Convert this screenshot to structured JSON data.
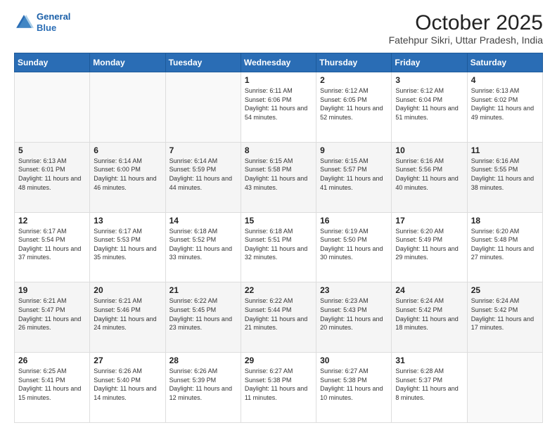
{
  "header": {
    "logo": {
      "line1": "General",
      "line2": "Blue"
    },
    "title": "October 2025",
    "subtitle": "Fatehpur Sikri, Uttar Pradesh, India"
  },
  "weekdays": [
    "Sunday",
    "Monday",
    "Tuesday",
    "Wednesday",
    "Thursday",
    "Friday",
    "Saturday"
  ],
  "weeks": [
    [
      {
        "day": "",
        "sunrise": "",
        "sunset": "",
        "daylight": ""
      },
      {
        "day": "",
        "sunrise": "",
        "sunset": "",
        "daylight": ""
      },
      {
        "day": "",
        "sunrise": "",
        "sunset": "",
        "daylight": ""
      },
      {
        "day": "1",
        "sunrise": "Sunrise: 6:11 AM",
        "sunset": "Sunset: 6:06 PM",
        "daylight": "Daylight: 11 hours and 54 minutes."
      },
      {
        "day": "2",
        "sunrise": "Sunrise: 6:12 AM",
        "sunset": "Sunset: 6:05 PM",
        "daylight": "Daylight: 11 hours and 52 minutes."
      },
      {
        "day": "3",
        "sunrise": "Sunrise: 6:12 AM",
        "sunset": "Sunset: 6:04 PM",
        "daylight": "Daylight: 11 hours and 51 minutes."
      },
      {
        "day": "4",
        "sunrise": "Sunrise: 6:13 AM",
        "sunset": "Sunset: 6:02 PM",
        "daylight": "Daylight: 11 hours and 49 minutes."
      }
    ],
    [
      {
        "day": "5",
        "sunrise": "Sunrise: 6:13 AM",
        "sunset": "Sunset: 6:01 PM",
        "daylight": "Daylight: 11 hours and 48 minutes."
      },
      {
        "day": "6",
        "sunrise": "Sunrise: 6:14 AM",
        "sunset": "Sunset: 6:00 PM",
        "daylight": "Daylight: 11 hours and 46 minutes."
      },
      {
        "day": "7",
        "sunrise": "Sunrise: 6:14 AM",
        "sunset": "Sunset: 5:59 PM",
        "daylight": "Daylight: 11 hours and 44 minutes."
      },
      {
        "day": "8",
        "sunrise": "Sunrise: 6:15 AM",
        "sunset": "Sunset: 5:58 PM",
        "daylight": "Daylight: 11 hours and 43 minutes."
      },
      {
        "day": "9",
        "sunrise": "Sunrise: 6:15 AM",
        "sunset": "Sunset: 5:57 PM",
        "daylight": "Daylight: 11 hours and 41 minutes."
      },
      {
        "day": "10",
        "sunrise": "Sunrise: 6:16 AM",
        "sunset": "Sunset: 5:56 PM",
        "daylight": "Daylight: 11 hours and 40 minutes."
      },
      {
        "day": "11",
        "sunrise": "Sunrise: 6:16 AM",
        "sunset": "Sunset: 5:55 PM",
        "daylight": "Daylight: 11 hours and 38 minutes."
      }
    ],
    [
      {
        "day": "12",
        "sunrise": "Sunrise: 6:17 AM",
        "sunset": "Sunset: 5:54 PM",
        "daylight": "Daylight: 11 hours and 37 minutes."
      },
      {
        "day": "13",
        "sunrise": "Sunrise: 6:17 AM",
        "sunset": "Sunset: 5:53 PM",
        "daylight": "Daylight: 11 hours and 35 minutes."
      },
      {
        "day": "14",
        "sunrise": "Sunrise: 6:18 AM",
        "sunset": "Sunset: 5:52 PM",
        "daylight": "Daylight: 11 hours and 33 minutes."
      },
      {
        "day": "15",
        "sunrise": "Sunrise: 6:18 AM",
        "sunset": "Sunset: 5:51 PM",
        "daylight": "Daylight: 11 hours and 32 minutes."
      },
      {
        "day": "16",
        "sunrise": "Sunrise: 6:19 AM",
        "sunset": "Sunset: 5:50 PM",
        "daylight": "Daylight: 11 hours and 30 minutes."
      },
      {
        "day": "17",
        "sunrise": "Sunrise: 6:20 AM",
        "sunset": "Sunset: 5:49 PM",
        "daylight": "Daylight: 11 hours and 29 minutes."
      },
      {
        "day": "18",
        "sunrise": "Sunrise: 6:20 AM",
        "sunset": "Sunset: 5:48 PM",
        "daylight": "Daylight: 11 hours and 27 minutes."
      }
    ],
    [
      {
        "day": "19",
        "sunrise": "Sunrise: 6:21 AM",
        "sunset": "Sunset: 5:47 PM",
        "daylight": "Daylight: 11 hours and 26 minutes."
      },
      {
        "day": "20",
        "sunrise": "Sunrise: 6:21 AM",
        "sunset": "Sunset: 5:46 PM",
        "daylight": "Daylight: 11 hours and 24 minutes."
      },
      {
        "day": "21",
        "sunrise": "Sunrise: 6:22 AM",
        "sunset": "Sunset: 5:45 PM",
        "daylight": "Daylight: 11 hours and 23 minutes."
      },
      {
        "day": "22",
        "sunrise": "Sunrise: 6:22 AM",
        "sunset": "Sunset: 5:44 PM",
        "daylight": "Daylight: 11 hours and 21 minutes."
      },
      {
        "day": "23",
        "sunrise": "Sunrise: 6:23 AM",
        "sunset": "Sunset: 5:43 PM",
        "daylight": "Daylight: 11 hours and 20 minutes."
      },
      {
        "day": "24",
        "sunrise": "Sunrise: 6:24 AM",
        "sunset": "Sunset: 5:42 PM",
        "daylight": "Daylight: 11 hours and 18 minutes."
      },
      {
        "day": "25",
        "sunrise": "Sunrise: 6:24 AM",
        "sunset": "Sunset: 5:42 PM",
        "daylight": "Daylight: 11 hours and 17 minutes."
      }
    ],
    [
      {
        "day": "26",
        "sunrise": "Sunrise: 6:25 AM",
        "sunset": "Sunset: 5:41 PM",
        "daylight": "Daylight: 11 hours and 15 minutes."
      },
      {
        "day": "27",
        "sunrise": "Sunrise: 6:26 AM",
        "sunset": "Sunset: 5:40 PM",
        "daylight": "Daylight: 11 hours and 14 minutes."
      },
      {
        "day": "28",
        "sunrise": "Sunrise: 6:26 AM",
        "sunset": "Sunset: 5:39 PM",
        "daylight": "Daylight: 11 hours and 12 minutes."
      },
      {
        "day": "29",
        "sunrise": "Sunrise: 6:27 AM",
        "sunset": "Sunset: 5:38 PM",
        "daylight": "Daylight: 11 hours and 11 minutes."
      },
      {
        "day": "30",
        "sunrise": "Sunrise: 6:27 AM",
        "sunset": "Sunset: 5:38 PM",
        "daylight": "Daylight: 11 hours and 10 minutes."
      },
      {
        "day": "31",
        "sunrise": "Sunrise: 6:28 AM",
        "sunset": "Sunset: 5:37 PM",
        "daylight": "Daylight: 11 hours and 8 minutes."
      },
      {
        "day": "",
        "sunrise": "",
        "sunset": "",
        "daylight": ""
      }
    ]
  ]
}
